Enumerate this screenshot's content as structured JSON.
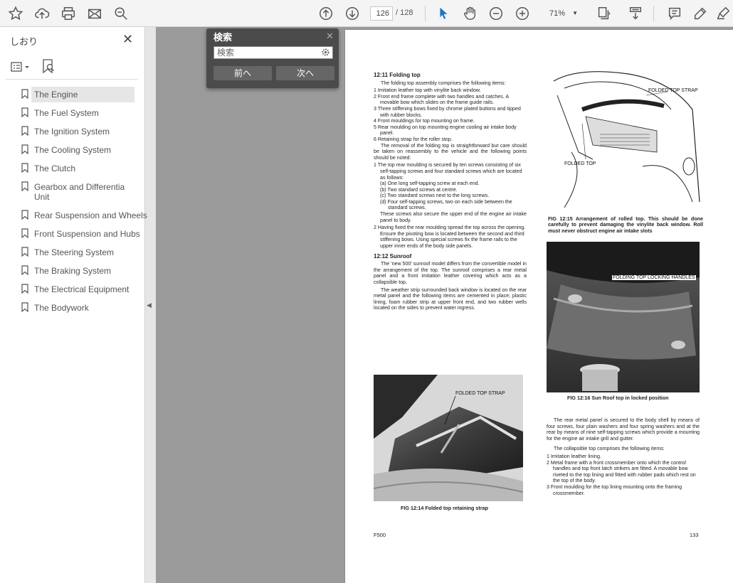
{
  "toolbar": {
    "page_current": "126",
    "page_total": "/ 128",
    "zoom": "71%",
    "icons": [
      "star-icon",
      "cloud-upload-icon",
      "print-icon",
      "mail-icon",
      "zoom-search-icon",
      "page-up-icon",
      "page-down-icon",
      "select-cursor-icon",
      "hand-icon",
      "zoom-out-icon",
      "zoom-in-icon",
      "page-fit-icon",
      "scroll-mode-icon",
      "comment-icon",
      "pen-icon",
      "highlight-icon"
    ]
  },
  "sidebar": {
    "title": "しおり",
    "items": [
      {
        "label": "The Engine",
        "selected": true
      },
      {
        "label": "The Fuel System"
      },
      {
        "label": "The Ignition System"
      },
      {
        "label": "The Cooling System"
      },
      {
        "label": "The Clutch"
      },
      {
        "label": "Gearbox and Differentia Unit"
      },
      {
        "label": "Rear Suspension and Wheels"
      },
      {
        "label": "Front Suspension and Hubs"
      },
      {
        "label": "The Steering System"
      },
      {
        "label": "The Braking System"
      },
      {
        "label": "The Electrical Equipment"
      },
      {
        "label": "The Bodywork"
      }
    ]
  },
  "find": {
    "title": "検索",
    "placeholder": "検索",
    "prev": "前へ",
    "next": "次へ"
  },
  "document": {
    "left": {
      "h1": "12:11 Folding top",
      "p1": "The folding top assembly comprises the following items:",
      "list1": [
        "1 Imitation leather top with vinylite back window.",
        "2 Front end frame complete with two handles and catches. A movable bow which slides on the frame guide rails.",
        "3 Three stiffening bows fixed by chrome plated buttons and tipped with rubber blocks.",
        "4 Front mouldings for top mounting on frame.",
        "5 Rear moulding on top mounting engine cooling air intake body panel.",
        "6 Retaining strap for the roller stop."
      ],
      "p2": "The removal of the folding top is straightforward but care should be taken on reassembly to the vehicle and the following points should be noted:",
      "list2a": "1 The top rear moulding is secured by ten screws consisting of six self-tapping screws and four standard screws which are located as follows:",
      "list2a_sub": [
        "(a) One long self-tapping screw at each end.",
        "(b) Two standard screws at centre.",
        "(c) Two standard screws next to the long screws.",
        "(d) Four self-tapping screws, two on each side between the standard screws."
      ],
      "p3": "These screws also secure the upper end of the engine air intake panel to body.",
      "list2b": "2 Having fixed the rear moulding spread the top across the opening. Ensure the pivoting bow is located between the second and third stiffening bows. Using special screws fix the frame rails to the upper inner ends of the body side panels.",
      "h2": "12:12 Sunroof",
      "p4": "The 'new 500' sunroof model differs from the convertible model in the arrangement of the top. The sunroof comprises a rear metal panel and a front imitation leather covering which acts as a collapsible top.",
      "p5": "The weather strip surrounded back window is located on the rear metal panel and the following items are cemented in place; plastic lining, foam rubber strip at upper front end, and two rubber wells located on the sides to prevent water ingress.",
      "fig14_label": "FOLDED TOP STRAP",
      "fig14_caption": "FIG 12:14 Folded top retaining strap"
    },
    "right": {
      "fig15_label1": "FOLDED TOP STRAP",
      "fig15_label2": "FOLDED TOP",
      "fig15_caption": "FIG 12:15 Arrangement of rolled top. This should be done carefully to prevent damaging the vinylite back window. Roll must never obstruct engine air intake slots",
      "fig16_label": "FOLDING TOP LOCKING HANDLES",
      "fig16_caption": "FIG 12:16 Sun Roof top in locked position",
      "p1": "The rear metal panel is secured to the body shell by means of four screws, four plain washers and four spring washers and at the rear by means of nine self-tapping screws which provide a mounting for the engine air intake grill and gutter.",
      "p2": "The collapsible top comprises the following items:",
      "list": [
        "1 Imitation leather lining.",
        "2 Metal frame with a front crossmember onto which the control handles and top front latch strikers are fitted. A movable bow riveted to the top lining and fitted with rubber pads which rest on the top of the body.",
        "3 Front moulding for the top lining mounting onto the framing crossmember."
      ]
    },
    "footer_left": "F500",
    "footer_right": "133"
  }
}
